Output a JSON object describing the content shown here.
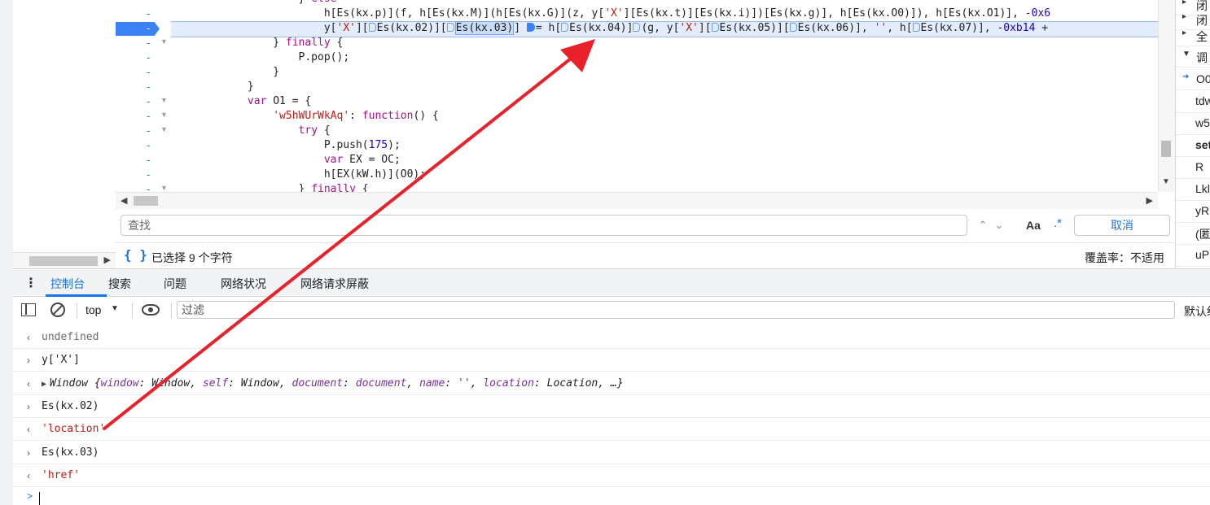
{
  "editor": {
    "lines": [
      "                    } else",
      "                        h[Es(kx.p)](f, h[Es(kx.M)](h[Es(kx.G)](z, y['X'][Es(kx.t)][Es(kx.i)])[Es(kx.g)], h[Es(kx.O0)]), h[Es(kx.O1)], -0x6",
      "",
      "                } finally {",
      "                    P.pop();",
      "                }",
      "            }",
      "            var O1 = {",
      "                'w5hWUrWkAq': function() {",
      "                    try {",
      "                        P.push(175);",
      "                        var EX = OC;",
      "                        h[EX(kW.h)](O0);",
      "                    } finally {"
    ],
    "exec_line": {
      "indent": "                        ",
      "p1": "y[",
      "s1": "'X'",
      "p2": "][",
      "p3": "Es(kx.02)][",
      "sel": "Es(kx.03)",
      "p4": "] ",
      "p5": "= h[",
      "p6": "Es(kx.04)]",
      "p7": "(g, y[",
      "s2": "'X'",
      "p8": "][",
      "p9": "Es(kx.05)][",
      "p10": "Es(kx.06)], ",
      "s3": "''",
      "p11": ", h[",
      "p12": "Es(kx.07)], ",
      "n1": "-0xb14",
      "p13": " +"
    },
    "breakpoint_marker": "-",
    "gutter_marker": "-"
  },
  "find": {
    "placeholder": "查找",
    "value": "",
    "prev": "⌃",
    "next": "⌄",
    "match_case": "Aa",
    "regex": ".*",
    "cancel": "取消"
  },
  "status": {
    "pretty_print": "{ }",
    "selection": "已选择 9 个字符",
    "coverage": "覆盖率：不适用"
  },
  "right_panel": {
    "items": [
      {
        "arrow": "▸",
        "text": "闭"
      },
      {
        "arrow": "▸",
        "text": "闭"
      },
      {
        "arrow": "▸",
        "text": "全"
      },
      {
        "arrow": "▼",
        "text": "调"
      },
      {
        "arrow": "➜",
        "text": "O0"
      },
      {
        "arrow": "",
        "text": "tdw"
      },
      {
        "arrow": "",
        "text": "w5"
      },
      {
        "arrow": "",
        "text": "set"
      },
      {
        "arrow": "",
        "text": "R"
      },
      {
        "arrow": "",
        "text": "Lkl"
      },
      {
        "arrow": "",
        "text": "yR"
      },
      {
        "arrow": "",
        "text": "(匿"
      },
      {
        "arrow": "",
        "text": "uP"
      }
    ]
  },
  "drawer": {
    "menu": "⋮",
    "tabs": [
      "控制台",
      "搜索",
      "问题",
      "网络状况",
      "网络请求屏蔽"
    ],
    "active_tab": "控制台"
  },
  "console_toolbar": {
    "context": "top",
    "filter_placeholder": "过滤",
    "default_levels": "默认级别"
  },
  "console": {
    "rows": [
      {
        "type": "result",
        "glyph": "<",
        "text": "undefined"
      },
      {
        "type": "input",
        "glyph": ">",
        "text": "y['X']"
      },
      {
        "type": "result-window",
        "glyph": "<",
        "expander": "▶",
        "text": "Window {window: Window, self: Window, document: document, name: '', location: Location, …}"
      },
      {
        "type": "input",
        "glyph": ">",
        "text": "Es(kx.02)"
      },
      {
        "type": "result-string",
        "glyph": "<",
        "text": "'location'"
      },
      {
        "type": "input",
        "glyph": ">",
        "text": "Es(kx.03)"
      },
      {
        "type": "result-string",
        "glyph": "<",
        "text": "'href'"
      }
    ],
    "prompt": ">"
  },
  "annotation": {
    "color": "#e8212a"
  },
  "colors": {
    "accent": "#1a73e8",
    "exec_highlight": "#e3ecfb",
    "string": "#c41a16"
  }
}
